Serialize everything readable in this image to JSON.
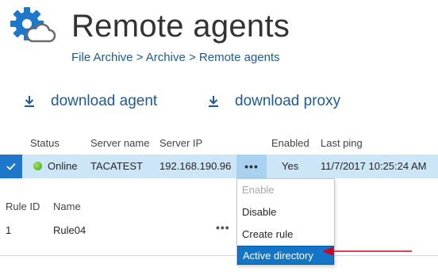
{
  "header": {
    "title": "Remote agents",
    "breadcrumb": "File Archive > Archive > Remote agents",
    "logo_icon": "gear-cloud-icon"
  },
  "toolbar": {
    "download_agent_label": "download agent",
    "download_proxy_label": "download proxy",
    "download_icon": "download-icon"
  },
  "agents_table": {
    "columns": {
      "status": "Status",
      "server_name": "Server name",
      "server_ip": "Server IP",
      "enabled": "Enabled",
      "last_ping": "Last ping"
    },
    "rows": [
      {
        "selected": true,
        "status": "Online",
        "status_color": "#3ba51e",
        "server_name": "TACATEST",
        "server_ip": "192.168.190.96",
        "actions": "•••",
        "enabled": "Yes",
        "last_ping": "11/7/2017 10:25:24 AM"
      }
    ]
  },
  "context_menu": {
    "items": [
      {
        "label": "Enable",
        "disabled": true
      },
      {
        "label": "Disable",
        "disabled": false
      },
      {
        "label": "Create rule",
        "disabled": false
      },
      {
        "label": "Active directory",
        "disabled": false,
        "highlighted": true
      }
    ]
  },
  "rules_table": {
    "columns": {
      "rule_id": "Rule ID",
      "name": "Name"
    },
    "rows": [
      {
        "rule_id": "1",
        "name": "Rule04",
        "actions": "•••"
      }
    ]
  },
  "colors": {
    "accent_blue": "#1474c8",
    "link_blue": "#1e5a95",
    "row_selected_bg": "#cde6f7",
    "annotation_arrow": "#d0021b"
  }
}
